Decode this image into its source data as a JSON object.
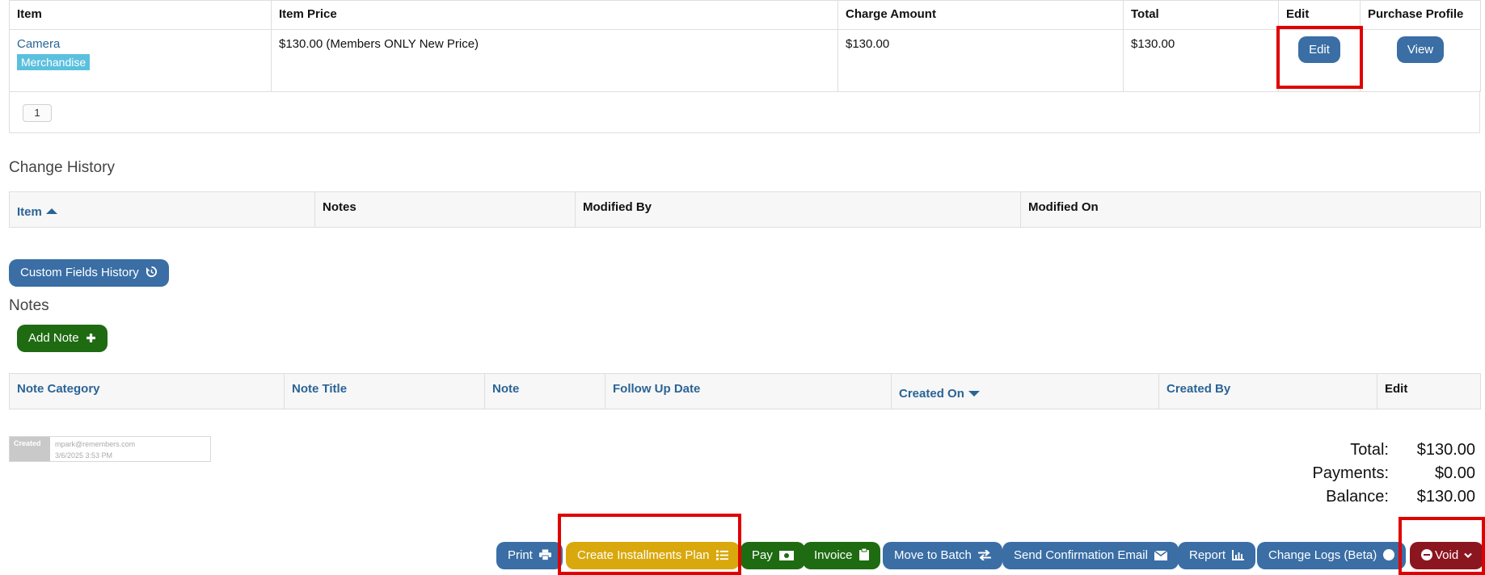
{
  "items_table": {
    "headers": [
      "Item",
      "Item Price",
      "Charge Amount",
      "Total",
      "Edit",
      "Purchase Profile"
    ],
    "rows": [
      {
        "item": "Camera",
        "tag": "Merchandise",
        "item_price": "$130.00 (Members ONLY New Price)",
        "charge_amount": "$130.00",
        "total": "$130.00",
        "edit_label": "Edit",
        "view_label": "View"
      }
    ],
    "pager": "1"
  },
  "change_history": {
    "title": "Change History",
    "headers": [
      "Item",
      "Notes",
      "Modified By",
      "Modified On"
    ]
  },
  "custom_fields_button": "Custom Fields History",
  "notes": {
    "title": "Notes",
    "add_button": "Add Note",
    "headers": [
      "Note Category",
      "Note Title",
      "Note",
      "Follow Up Date",
      "Created On",
      "Created By",
      "Edit"
    ]
  },
  "created": {
    "label": "Created",
    "user": "mpark@remembers.com",
    "date": "3/6/2025 3:53 PM"
  },
  "totals": {
    "total_label": "Total:",
    "total_value": "$130.00",
    "payments_label": "Payments:",
    "payments_value": "$0.00",
    "balance_label": "Balance:",
    "balance_value": "$130.00"
  },
  "toolbar": {
    "print": "Print",
    "installments": "Create Installments Plan",
    "pay": "Pay",
    "invoice": "Invoice",
    "move_batch": "Move to Batch",
    "send_email": "Send Confirmation Email",
    "report": "Report",
    "change_logs": "Change Logs (Beta)",
    "void": "Void"
  },
  "colors": {
    "primary": "#3a6ea5",
    "success": "#1e6b12",
    "warning": "#d9a80c",
    "danger": "#8b1620",
    "link": "#2a6496",
    "tag": "#5bc0de",
    "highlight": "#e00000"
  }
}
